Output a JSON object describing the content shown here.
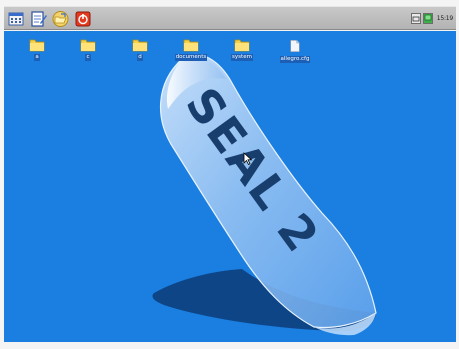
{
  "taskbar": {
    "start_icons": [
      "calendar-icon",
      "notes-icon",
      "folder-open-icon",
      "power-icon"
    ],
    "tray": {
      "icons": [
        "keyboard-icon",
        "monitor-icon"
      ],
      "clock": "15:19"
    }
  },
  "desktop": {
    "background_color": "#1a7fe0",
    "icons": [
      {
        "label": "a",
        "type": "folder-icon"
      },
      {
        "label": "c",
        "type": "folder-icon"
      },
      {
        "label": "d",
        "type": "folder-icon"
      },
      {
        "label": "documents",
        "type": "folder-icon"
      },
      {
        "label": "system",
        "type": "folder-icon"
      },
      {
        "label": "allegro.cfg",
        "type": "file-icon"
      }
    ],
    "wallpaper_logo_text": "SEAL 2"
  },
  "colors": {
    "desktop": "#1a7fe0",
    "taskbar": "#bfbfbf",
    "label_bg": "#1d5fb4",
    "folder": "#f5d24a"
  }
}
